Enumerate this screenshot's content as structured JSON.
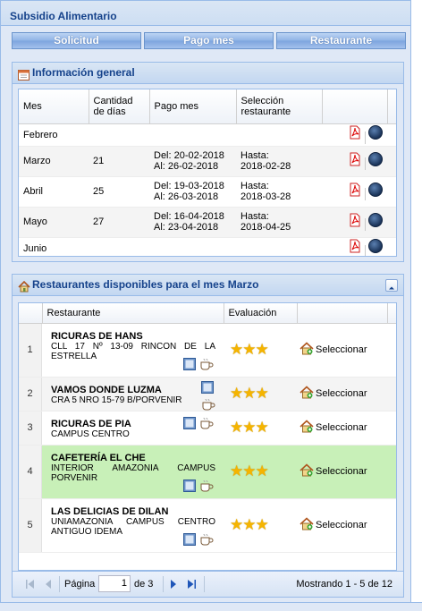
{
  "app": {
    "title": "Subsidio Alimentario"
  },
  "tabs": [
    {
      "label": "Solicitud"
    },
    {
      "label": "Pago mes"
    },
    {
      "label": "Restaurante"
    }
  ],
  "info_panel": {
    "title": "Información general",
    "columns": [
      "Mes",
      "Cantidad de días",
      "Pago mes",
      "Selección restaurante"
    ],
    "rows": [
      {
        "mes": "Febrero",
        "dias": "",
        "pago1": "",
        "pago2": "",
        "sel1": "",
        "sel2": ""
      },
      {
        "mes": "Marzo",
        "dias": "21",
        "pago1": "Del: 20-02-2018",
        "pago2": "Al: 26-02-2018",
        "sel1": "Hasta:",
        "sel2": "2018-02-28"
      },
      {
        "mes": "Abril",
        "dias": "25",
        "pago1": "Del: 19-03-2018",
        "pago2": "Al: 26-03-2018",
        "sel1": "Hasta:",
        "sel2": "2018-03-28"
      },
      {
        "mes": "Mayo",
        "dias": "27",
        "pago1": "Del: 16-04-2018",
        "pago2": "Al: 23-04-2018",
        "sel1": "Hasta:",
        "sel2": "2018-04-25"
      },
      {
        "mes": "Junio",
        "dias": "",
        "pago1": "",
        "pago2": "",
        "sel1": "",
        "sel2": ""
      }
    ]
  },
  "rest_panel": {
    "title": "Restaurantes disponibles para el mes Marzo",
    "columns": [
      "Restaurante",
      "Evaluación"
    ],
    "select_label": "Seleccionar",
    "rows": [
      {
        "num": "1",
        "name": "RICURAS DE HANS",
        "addr": "CLL 17 Nº 13-09 RINCON DE LA ESTRELLA",
        "stars": 3,
        "highlight": false
      },
      {
        "num": "2",
        "name": "VAMOS DONDE LUZMA",
        "addr": "CRA 5 NRO 15-79 B/PORVENIR",
        "stars": 3,
        "highlight": false
      },
      {
        "num": "3",
        "name": "RICURAS DE PIA",
        "addr": "CAMPUS CENTRO",
        "stars": 3,
        "highlight": false
      },
      {
        "num": "4",
        "name": "CAFETERÍA EL CHE",
        "addr": "INTERIOR AMAZONIA CAMPUS PORVENIR",
        "stars": 3,
        "highlight": true
      },
      {
        "num": "5",
        "name": "LAS DELICIAS DE DILAN",
        "addr": "UNIAMAZONIA CAMPUS CENTRO ANTIGUO IDEMA",
        "stars": 3,
        "highlight": false
      }
    ],
    "pager": {
      "page_label": "Página",
      "page_value": "1",
      "of_label": "de 3",
      "status": "Mostrando 1 - 5 de 12"
    }
  },
  "colors": {
    "accent": "#15428b",
    "highlight_row": "#c8f0b8",
    "star": "#f5b400"
  }
}
